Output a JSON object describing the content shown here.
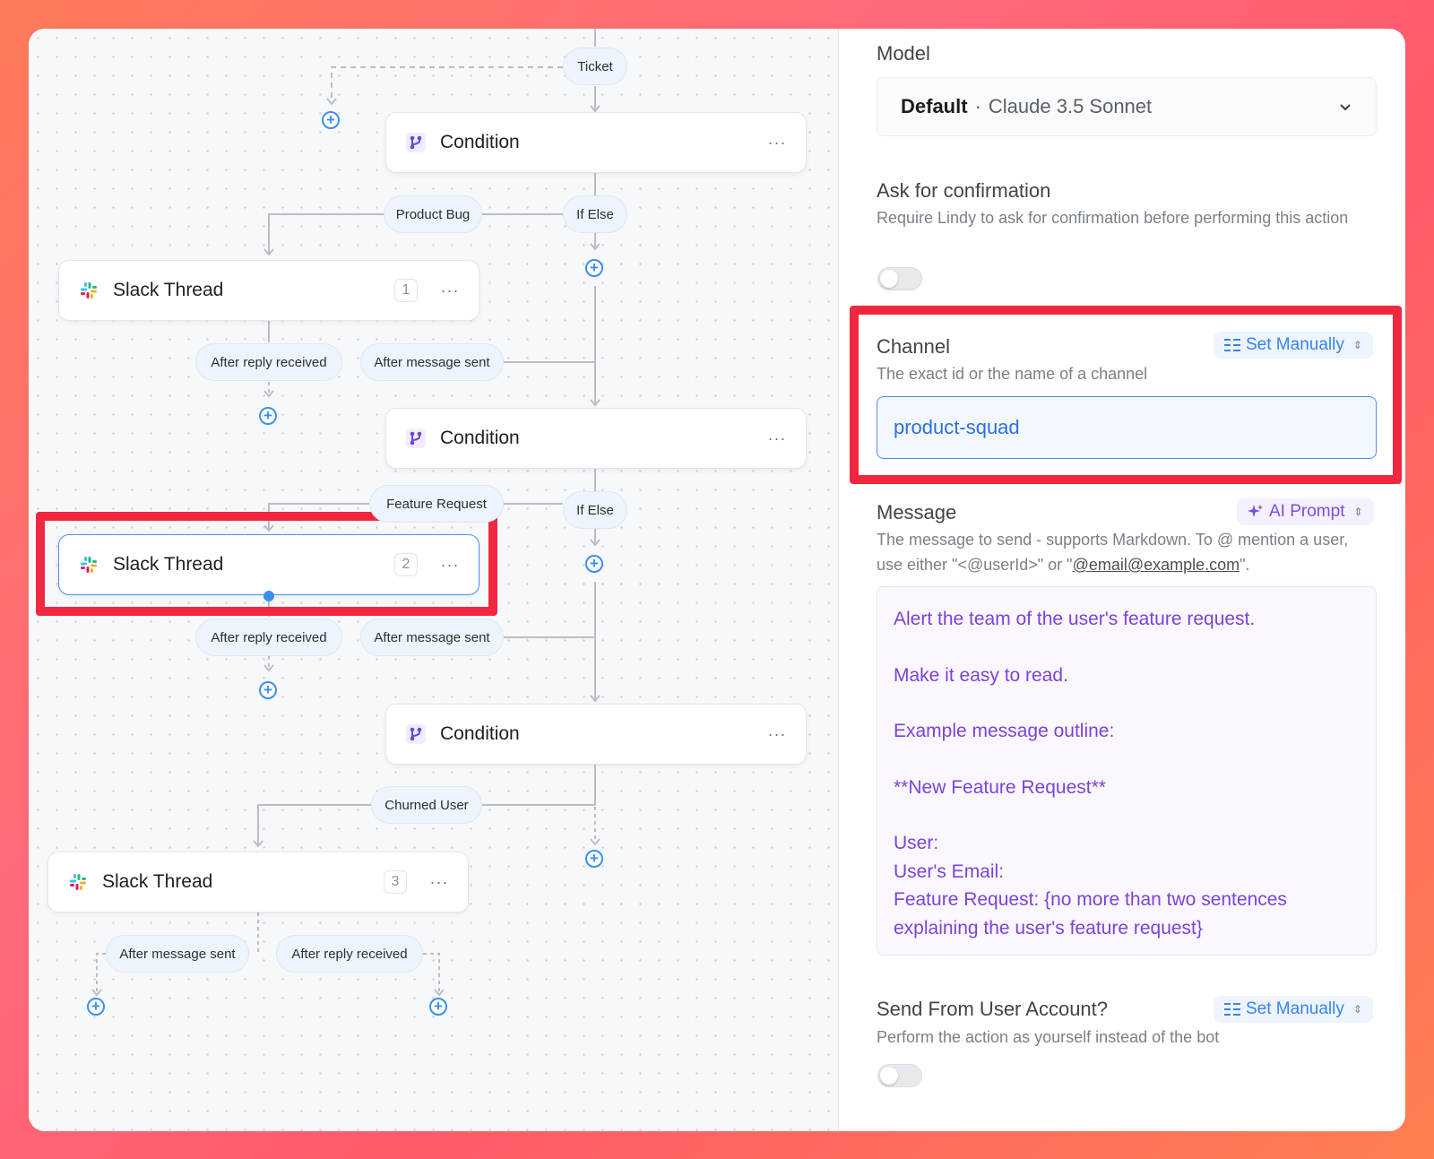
{
  "flow": {
    "edge_labels": {
      "ticket": "Ticket",
      "product_bug": "Product Bug",
      "if_else_1": "If Else",
      "feature_request": "Feature Request",
      "if_else_2": "If Else",
      "churned_user": "Churned User",
      "after_reply_1": "After reply received",
      "after_sent_1": "After message sent",
      "after_reply_2": "After reply received",
      "after_sent_2": "After message sent",
      "after_sent_3": "After message sent",
      "after_reply_3": "After reply received"
    },
    "conditions": [
      {
        "title": "Condition",
        "menu": "···"
      },
      {
        "title": "Condition",
        "menu": "···"
      },
      {
        "title": "Condition",
        "menu": "···"
      }
    ],
    "slack_threads": [
      {
        "title": "Slack Thread",
        "badge": "1",
        "menu": "···"
      },
      {
        "title": "Slack Thread",
        "badge": "2",
        "menu": "···"
      },
      {
        "title": "Slack Thread",
        "badge": "3",
        "menu": "···"
      }
    ],
    "add_icon": "+"
  },
  "panel": {
    "model": {
      "label": "Model",
      "selected_name": "Default",
      "separator": "·",
      "selected_detail": "Claude 3.5 Sonnet"
    },
    "confirmation": {
      "label": "Ask for confirmation",
      "description": "Require Lindy to ask for confirmation before performing this action",
      "enabled": false
    },
    "channel": {
      "label": "Channel",
      "mode": "Set Manually",
      "description": "The exact id or the name of a channel",
      "value": "product-squad"
    },
    "message": {
      "label": "Message",
      "mode": "AI Prompt",
      "description_pre": "The message to send - supports Markdown. To @ mention a user, use either \"<@userId>\" or \"",
      "description_link": "@email@example.com",
      "description_post": "\".",
      "lines": [
        "Alert the team of the user's feature request.",
        "",
        "Make it easy to read.",
        "",
        "Example message outline:",
        "",
        "**New Feature Request**",
        "",
        "User:",
        "User's Email:",
        "Feature Request: {no more than two sentences explaining the user's feature request}"
      ]
    },
    "send_from_user": {
      "label": "Send From User Account?",
      "mode": "Set Manually",
      "description": "Perform the action as yourself instead of the bot",
      "enabled": false
    }
  },
  "colors": {
    "highlight": "#f0273f",
    "accent_blue": "#3583f0",
    "ai_purple": "#7d42d8"
  }
}
